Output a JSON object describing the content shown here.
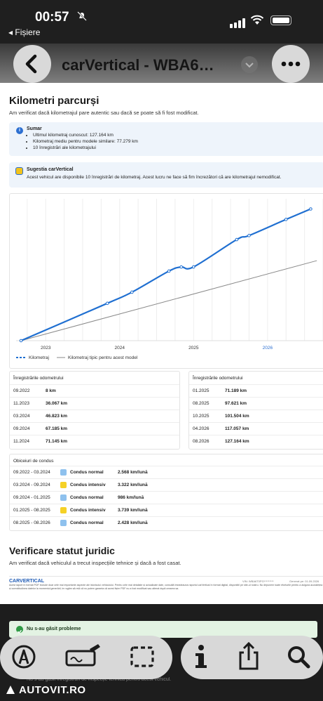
{
  "status": {
    "time": "00:57",
    "back_label": "◂ Fișiere"
  },
  "header": {
    "title": "carVertical - WBA6…"
  },
  "page": {
    "title": "Kilometri parcurși",
    "subtitle": "Am verificat dacă kilometrajul pare autentic sau dacă se poate să fi fost modificat.",
    "summary": {
      "title": "Sumar",
      "items": [
        "Ultimul kilometraj cunoscut: 127.164 km",
        "Kilometraj mediu pentru modele similare: 77.279 km",
        "10 înregistrări ale kilometrajului"
      ]
    },
    "suggestion": {
      "title": "Sugestia carVertical",
      "text": "Acest vehicul are disponibile 10 înregistrări de kilometraj. Acest lucru ne face să fim încrezători că are kilometrajul nemodificat."
    },
    "legend": {
      "series1": "Kilometraj",
      "series2": "Kilometraj tipic pentru acest model"
    },
    "records_title_left": "Înregistrările odometrului",
    "records_title_right": "Înregistrările odometrului",
    "records_left": [
      {
        "date": "09.2022",
        "km": "8 km"
      },
      {
        "date": "11.2023",
        "km": "36.067 km"
      },
      {
        "date": "03.2024",
        "km": "46.823 km"
      },
      {
        "date": "09.2024",
        "km": "67.185 km"
      },
      {
        "date": "11.2024",
        "km": "71.145 km"
      }
    ],
    "records_right": [
      {
        "date": "01.2025",
        "km": "71.189 km"
      },
      {
        "date": "08.2025",
        "km": "97.621 km"
      },
      {
        "date": "10.2025",
        "km": "101.504 km"
      },
      {
        "date": "04.2026",
        "km": "117.057 km"
      },
      {
        "date": "08.2026",
        "km": "127.164 km"
      }
    ],
    "habits_title": "Obiceiuri de condus",
    "habits": [
      {
        "period": "09.2022 - 03.2024",
        "style": "Condus normal",
        "rate": "2.568 km/lună",
        "color": "#8ec1ee"
      },
      {
        "period": "03.2024 - 09.2024",
        "style": "Condus intensiv",
        "rate": "3.322 km/lună",
        "color": "#f5d126"
      },
      {
        "period": "09.2024 - 01.2025",
        "style": "Condus normal",
        "rate": "986 km/lună",
        "color": "#8ec1ee"
      },
      {
        "period": "01.2025 - 08.2025",
        "style": "Condus intensiv",
        "rate": "3.739 km/lună",
        "color": "#f5d126"
      },
      {
        "period": "08.2025 - 08.2026",
        "style": "Condus normal",
        "rate": "2.428 km/lună",
        "color": "#8ec1ee"
      }
    ],
    "legal_title": "Verificare statut juridic",
    "legal_subtitle": "Am verificat dacă vehiculul a trecut inspecțiile tehnice și dacă a fost casat.",
    "footer_brand": "CARVERTICAL",
    "footer_vin": "VIN: WBA6T0PG*********",
    "footer_generated": "Generat pe: 01.09.2026",
    "footer_disclaimer": "Acest raport în format PDF include doar cele mai importante aspecte ale istoricului vehiculului. Pentru cele mai detaliate și actualizate date, consultă întotdeauna raportul carVertical în format digital, disponibil pe site-ul nostru. Nu depunem toate eforturile pentru a asigura acuratețea și corectitudinea datelor la momentul generării, te rugăm să reții că nu putem garanta că acest fișier PDF nu a fost modificat sau alterat după crearea sa."
  },
  "behind": {
    "no_problems": "Nu s-au găsit probleme",
    "no_records": "Nu s-au găsit înregistrări de inspecție tehnică pentru acest vehicul."
  },
  "watermark": "AUTOVIT.RO",
  "chart_data": {
    "type": "line",
    "x_ticks": [
      "2023",
      "2024",
      "2025",
      "2026"
    ],
    "series": [
      {
        "name": "Kilometraj",
        "color": "#1f6fd1",
        "points": [
          [
            "09.2022",
            8
          ],
          [
            "11.2023",
            36067
          ],
          [
            "03.2024",
            46823
          ],
          [
            "09.2024",
            67185
          ],
          [
            "11.2024",
            71145
          ],
          [
            "01.2025",
            71189
          ],
          [
            "08.2025",
            97621
          ],
          [
            "10.2025",
            101504
          ],
          [
            "04.2026",
            117057
          ],
          [
            "08.2026",
            127164
          ]
        ]
      },
      {
        "name": "Kilometraj tipic pentru acest model",
        "color": "#8a8a8a",
        "points": [
          [
            "09.2022",
            0
          ],
          [
            "09.2026",
            77279
          ]
        ]
      }
    ],
    "grid": true,
    "legend": "bottom-left"
  }
}
